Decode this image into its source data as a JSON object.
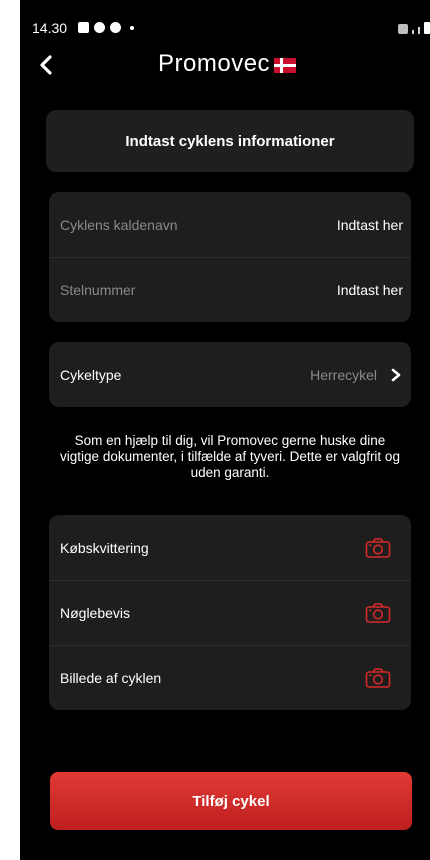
{
  "status_bar": {
    "time": "14.30"
  },
  "header": {
    "logo_text": "Promovec",
    "back_icon": "chevron-left-icon"
  },
  "title_card": {
    "title": "Indtast cyklens informationer"
  },
  "fields": [
    {
      "label": "Cyklens kaldenavn",
      "value": "Indtast her"
    },
    {
      "label": "Stelnummer",
      "value": "Indtast her"
    }
  ],
  "bike_type": {
    "label": "Cykeltype",
    "value": "Herrecykel"
  },
  "info": {
    "text": "Som en hjælp til dig, vil Promovec gerne huske dine vigtige dokumenter, i tilfælde af tyveri. Dette er valgfrit og uden garanti."
  },
  "documents": [
    {
      "label": "Købskvittering",
      "icon": "camera-icon"
    },
    {
      "label": "Nøglebevis",
      "icon": "camera-icon"
    },
    {
      "label": "Billede af cyklen",
      "icon": "camera-icon"
    }
  ],
  "submit": {
    "label": "Tilføj cykel"
  },
  "colors": {
    "background": "#000000",
    "card": "#1e1e1e",
    "accent_red": "#d42a28",
    "muted_text": "#8a8a8a"
  }
}
